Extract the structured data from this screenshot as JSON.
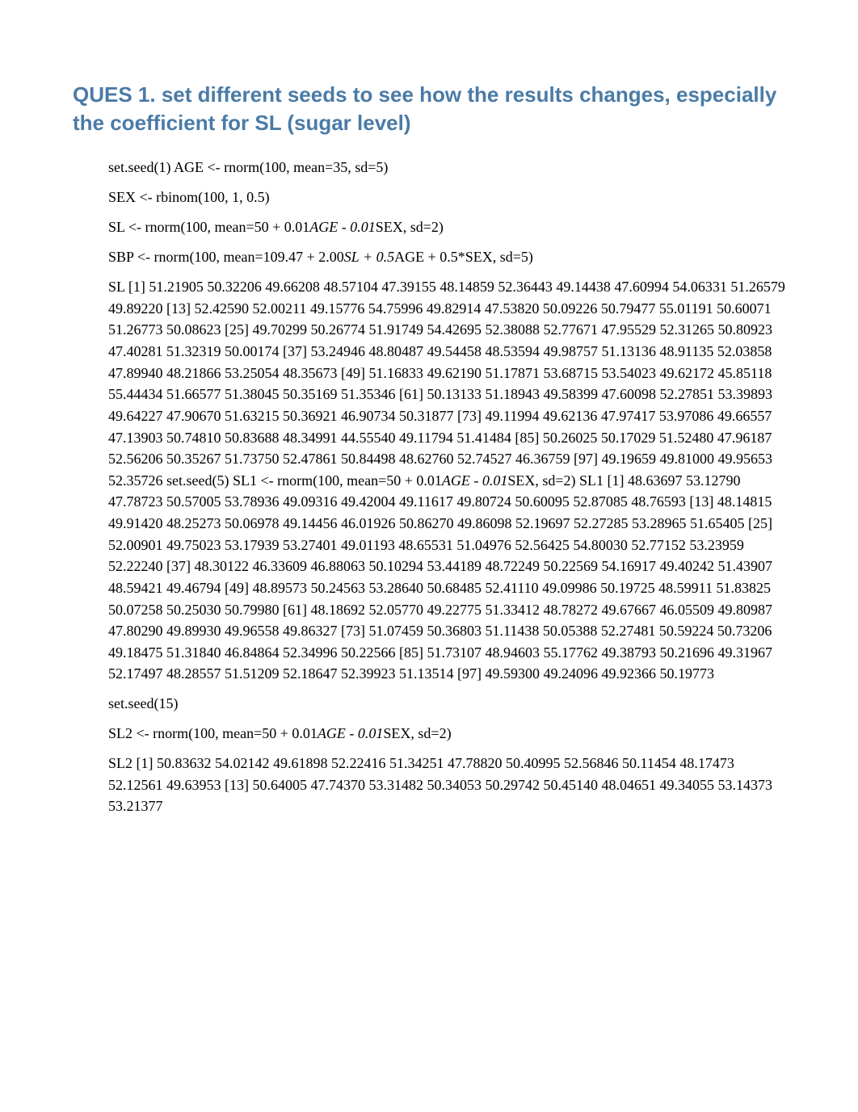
{
  "heading": "QUES 1. set different seeds to see how the results changes, especially the coefficient for SL (sugar level)",
  "lines": {
    "l1": "set.seed(1) AGE <- rnorm(100, mean=35, sd=5)",
    "l2": "SEX <- rbinom(100, 1, 0.5)",
    "l3_a": "SL <- rnorm(100, mean=50 + 0.01",
    "l3_b": "AGE - 0.01",
    "l3_c": "SEX, sd=2)",
    "l4_a": "SBP <- rnorm(100, mean=109.47 + 2.00",
    "l4_b": "SL + 0.5",
    "l4_c": "AGE + 0.5*SEX, sd=5)",
    "block1_a": "SL [1] 51.21905 50.32206 49.66208 48.57104 47.39155 48.14859 52.36443 49.14438 47.60994 54.06331 51.26579 49.89220 [13] 52.42590 52.00211 49.15776 54.75996 49.82914 47.53820 50.09226 50.79477 55.01191 50.60071 51.26773 50.08623 [25] 49.70299 50.26774 51.91749 54.42695 52.38088 52.77671 47.95529 52.31265 50.80923 47.40281 51.32319 50.00174 [37] 53.24946 48.80487 49.54458 48.53594 49.98757 51.13136 48.91135 52.03858 47.89940 48.21866 53.25054 48.35673 [49] 51.16833 49.62190 51.17871 53.68715 53.54023 49.62172 45.85118 55.44434 51.66577 51.38045 50.35169 51.35346 [61] 50.13133 51.18943 49.58399 47.60098 52.27851 53.39893 49.64227 47.90670 51.63215 50.36921 46.90734 50.31877 [73] 49.11994 49.62136 47.97417 53.97086 49.66557 47.13903 50.74810 50.83688 48.34991 44.55540 49.11794 51.41484 [85] 50.26025 50.17029 51.52480 47.96187 52.56206 50.35267 51.73750 52.47861 50.84498 48.62760 52.74527 46.36759 [97] 49.19659 49.81000 49.95653 52.35726 set.seed(5) SL1 <- rnorm(100, mean=50 + 0.01",
    "block1_b": "AGE - 0.01",
    "block1_c": "SEX, sd=2) SL1 [1] 48.63697 53.12790 47.78723 50.57005 53.78936 49.09316 49.42004 49.11617 49.80724 50.60095 52.87085 48.76593 [13] 48.14815 49.91420 48.25273 50.06978 49.14456 46.01926 50.86270 49.86098 52.19697 52.27285 53.28965 51.65405 [25] 52.00901 49.75023 53.17939 53.27401 49.01193 48.65531 51.04976 52.56425 54.80030 52.77152 53.23959 52.22240 [37] 48.30122 46.33609 46.88063 50.10294 53.44189 48.72249 50.22569 54.16917 49.40242 51.43907 48.59421 49.46794 [49] 48.89573 50.24563 53.28640 50.68485 52.41110 49.09986 50.19725 48.59911 51.83825 50.07258 50.25030 50.79980 [61] 48.18692 52.05770 49.22775 51.33412 48.78272 49.67667 46.05509 49.80987 47.80290 49.89930 49.96558 49.86327 [73] 51.07459 50.36803 51.11438 50.05388 52.27481 50.59224 50.73206 49.18475 51.31840 46.84864 52.34996 50.22566 [85] 51.73107 48.94603 55.17762 49.38793 50.21696 49.31967 52.17497 48.28557 51.51209 52.18647 52.39923 51.13514 [97] 49.59300 49.24096 49.92366 50.19773",
    "l6": "set.seed(15)",
    "l7_a": "SL2 <- rnorm(100, mean=50 + 0.01",
    "l7_b": "AGE - 0.01",
    "l7_c": "SEX, sd=2)",
    "block2": "SL2 [1] 50.83632 54.02142 49.61898 52.22416 51.34251 47.78820 50.40995 52.56846 50.11454 48.17473 52.12561 49.63953 [13] 50.64005 47.74370 53.31482 50.34053 50.29742 50.45140 48.04651 49.34055 53.14373 53.21377"
  }
}
